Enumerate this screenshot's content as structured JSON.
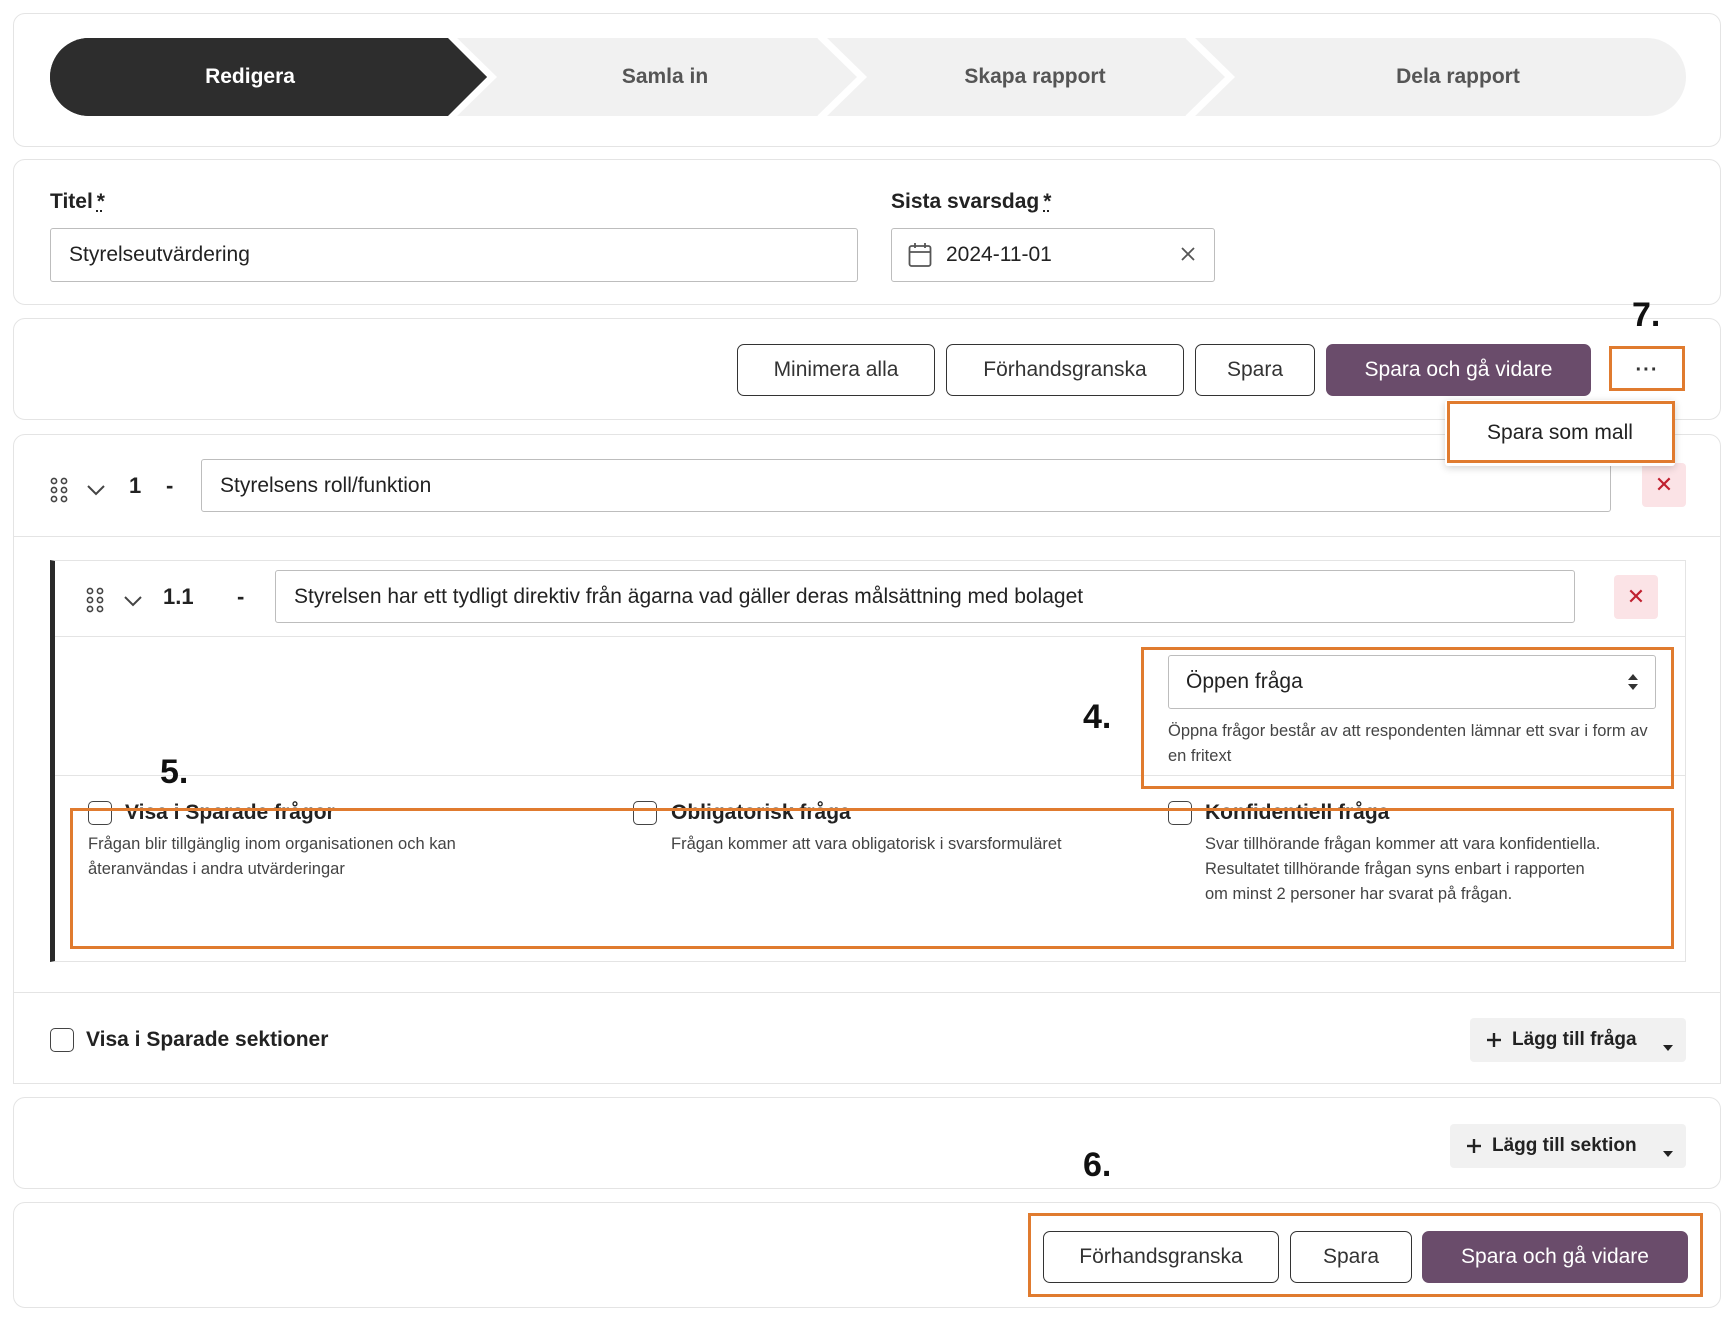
{
  "stepper": {
    "steps": [
      "Redigera",
      "Samla in",
      "Skapa rapport",
      "Dela rapport"
    ],
    "active_index": 0
  },
  "form": {
    "title_label": "Titel",
    "title_required": "*",
    "title_value": "Styrelseutvärdering",
    "deadline_label": "Sista svarsdag",
    "deadline_required": "*",
    "deadline_value": "2024-11-01"
  },
  "toolbar": {
    "minimize_all": "Minimera alla",
    "preview": "Förhandsgranska",
    "save": "Spara",
    "save_continue": "Spara och gå vidare",
    "more": "···",
    "more_menu": [
      "Spara som mall"
    ]
  },
  "section": {
    "number": "1",
    "dash": "-",
    "title": "Styrelsens roll/funktion",
    "show_in_saved_sections": "Visa i Sparade sektioner",
    "add_question": "Lägg till fråga"
  },
  "question": {
    "number": "1.1",
    "dash": "-",
    "text": "Styrelsen har ett tydligt direktiv från ägarna vad gäller deras målsättning med bolaget",
    "type_value": "Öppen fråga",
    "type_help": "Öppna frågor består av att respondenten lämnar ett svar i form av en fritext",
    "options": [
      {
        "title": "Visa i Sparade frågor",
        "desc_lines": [
          "Frågan blir tillgänglig inom organisationen och kan",
          "återanvändas i andra utvärderingar"
        ]
      },
      {
        "title": "Obligatorisk fråga",
        "desc_lines": [
          "Frågan kommer att vara obligatorisk i svarsformuläret"
        ]
      },
      {
        "title": "Konfidentiell fråga",
        "desc_lines": [
          "Svar tillhörande frågan kommer att vara konfidentiella.",
          "Resultatet tillhörande frågan syns enbart i rapporten",
          "om minst 2 personer har svarat på frågan."
        ]
      }
    ]
  },
  "add_section": {
    "label": "Lägg till sektion"
  },
  "bottom_bar": {
    "preview": "Förhandsgranska",
    "save": "Spara",
    "save_continue": "Spara och gå vidare"
  },
  "annotations": {
    "n4": "4.",
    "n5": "5.",
    "n6": "6.",
    "n7": "7."
  },
  "colors": {
    "primary": "#6a4c6b",
    "highlight": "#e07b2f",
    "danger_bg": "#fbe3e6",
    "danger": "#c0202f",
    "active_step": "#2d2d2d"
  }
}
